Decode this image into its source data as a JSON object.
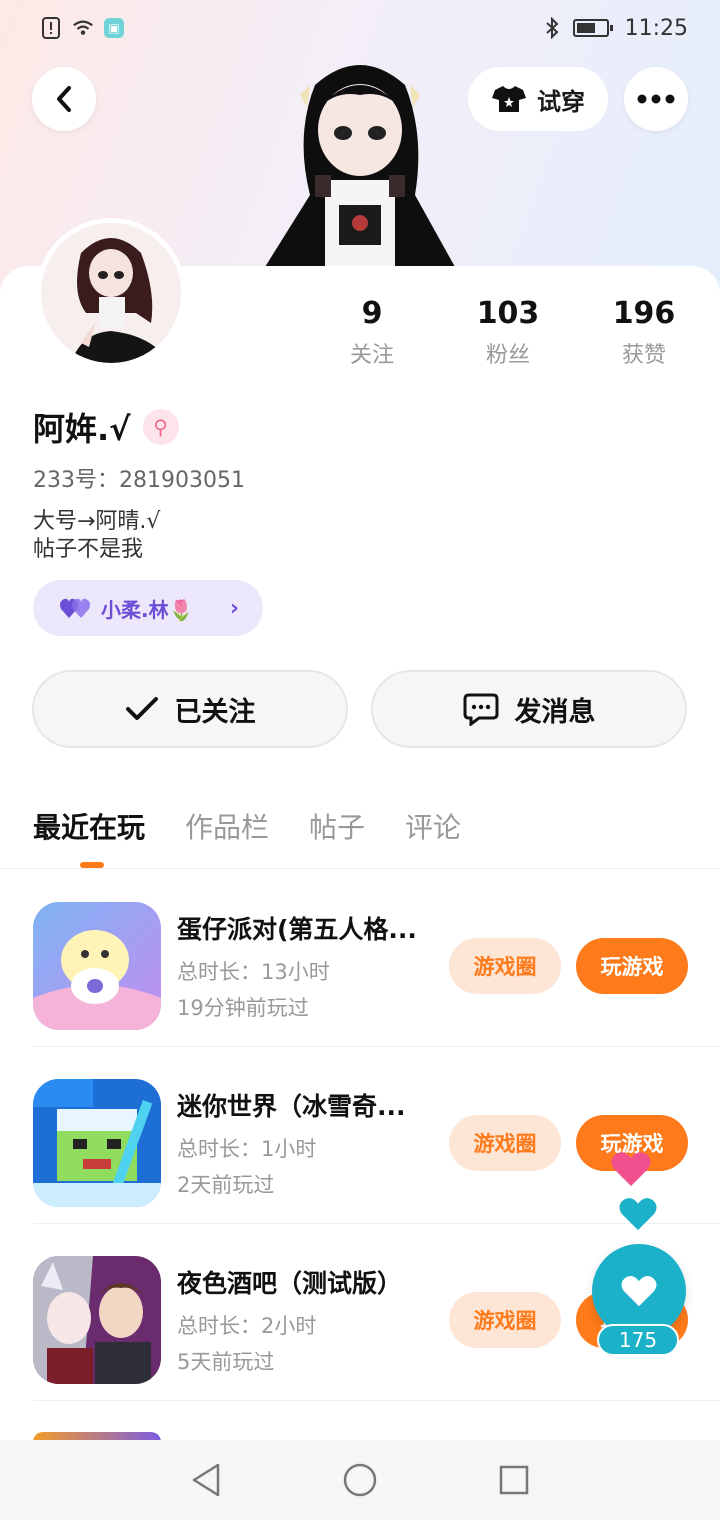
{
  "status_bar": {
    "time": "11:25",
    "icons": [
      "alert-icon",
      "wifi-icon",
      "shield-icon",
      "bluetooth-icon",
      "battery-icon"
    ]
  },
  "header": {
    "back_icon": "chevron-left-icon",
    "try_on_label": "试穿",
    "try_on_icon": "tshirt-icon",
    "more_icon": "more-horizontal-icon"
  },
  "profile": {
    "name": "阿姩.√",
    "gender_icon": "female-icon",
    "uid": "233号：281903051",
    "bio": [
      "大号→阿晴.√",
      "帖子不是我"
    ],
    "stats": [
      {
        "value": "9",
        "label": "关注"
      },
      {
        "value": "103",
        "label": "粉丝"
      },
      {
        "value": "196",
        "label": "获赞"
      }
    ],
    "cp_label": "小柔.林🌷"
  },
  "actions": {
    "follow_label": "已关注",
    "message_label": "发消息"
  },
  "tabs": [
    {
      "label": "最近在玩",
      "active": true
    },
    {
      "label": "作品栏",
      "active": false
    },
    {
      "label": "帖子",
      "active": false
    },
    {
      "label": "评论",
      "active": false
    }
  ],
  "games": [
    {
      "title": "蛋仔派对(第五人格...",
      "duration": "总时长：13小时",
      "last_played": "19分钟前玩过",
      "circle_label": "游戏圈",
      "play_label": "玩游戏"
    },
    {
      "title": "迷你世界（冰雪奇...",
      "duration": "总时长：1小时",
      "last_played": "2天前玩过",
      "circle_label": "游戏圈",
      "play_label": "玩游戏"
    },
    {
      "title": "夜色酒吧（测试版）",
      "duration": "总时长：2小时",
      "last_played": "5天前玩过",
      "circle_label": "游戏圈",
      "play_label": "玩游戏"
    }
  ],
  "float_like": {
    "count": "175"
  },
  "colors": {
    "accent": "#ff7a1a",
    "accent_light": "#fee6d6",
    "cp_purple": "#6b4fd6",
    "like_teal": "#1bb1c8"
  }
}
